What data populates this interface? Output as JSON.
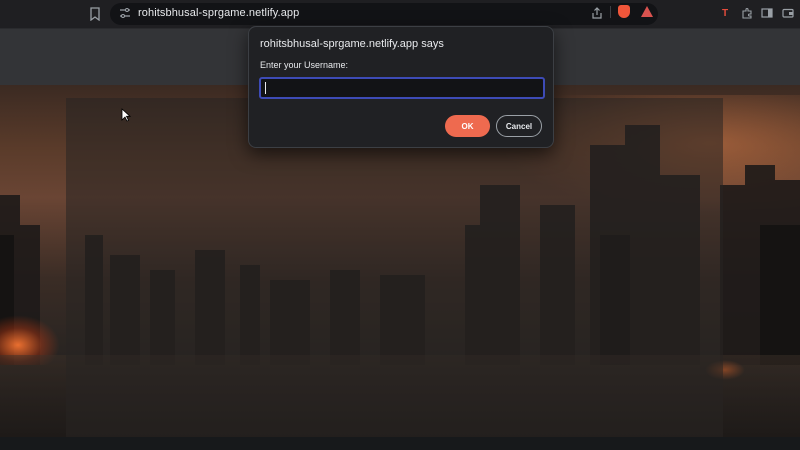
{
  "browser": {
    "url": "rohitsbhusal-sprgame.netlify.app",
    "icons": [
      "bookmark-icon",
      "site-info-icon",
      "share-icon",
      "brave-shields-icon",
      "brave-rewards-icon",
      "extension-icon",
      "extensions-puzzle-icon",
      "sidebar-icon",
      "wallet-icon"
    ],
    "brand_colors": {
      "brave": "#f0563a",
      "extension": "#e44c3c"
    }
  },
  "dialog": {
    "title": "rohitsbhusal-sprgame.netlify.app says",
    "message": "Enter your Username:",
    "input_value": "",
    "ok_label": "OK",
    "cancel_label": "Cancel",
    "ok_color": "#ee6a4f",
    "focus_color": "#3d4bb6"
  },
  "page": {
    "background": "post-apocalyptic city skyline at dusk"
  }
}
